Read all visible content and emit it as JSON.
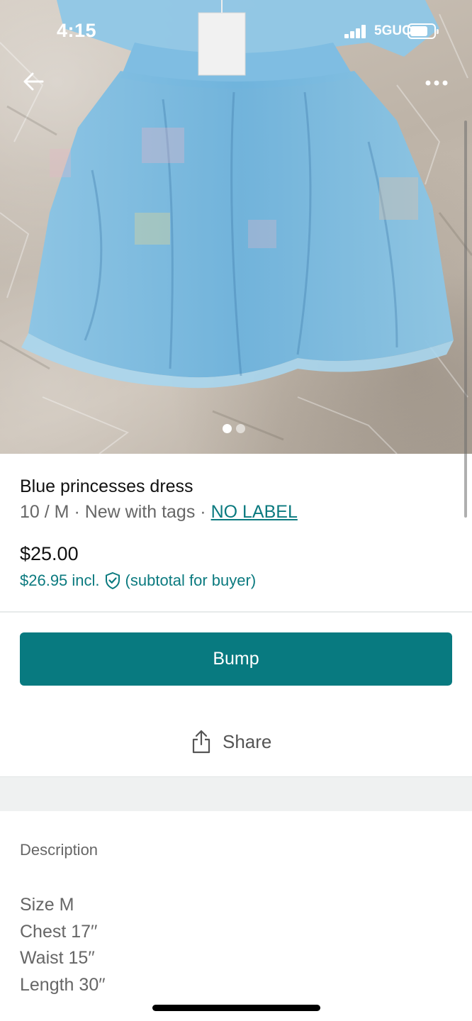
{
  "status_bar": {
    "time": "4:15",
    "network": "5GUC"
  },
  "listing": {
    "title": "Blue princesses dress",
    "size": "10 / M",
    "separator": "·",
    "condition": "New with tags",
    "brand": "NO LABEL",
    "price": "$25.00",
    "buyer_price": "$26.95 incl.",
    "buyer_note": "(subtotal for buyer)",
    "photo_count": 2,
    "active_photo": 1
  },
  "actions": {
    "bump_label": "Bump",
    "share_label": "Share"
  },
  "description": {
    "heading": "Description",
    "lines": [
      "Size M",
      "Chest 17′′",
      "Waist 15′′",
      "Length 30′′"
    ]
  },
  "colors": {
    "accent": "#087a80",
    "link": "#0b7a7f",
    "muted_text": "#666666"
  },
  "icons": {
    "back": "arrow-left-icon",
    "more": "more-dots-icon",
    "share": "share-icon",
    "protection": "shield-check-icon"
  }
}
